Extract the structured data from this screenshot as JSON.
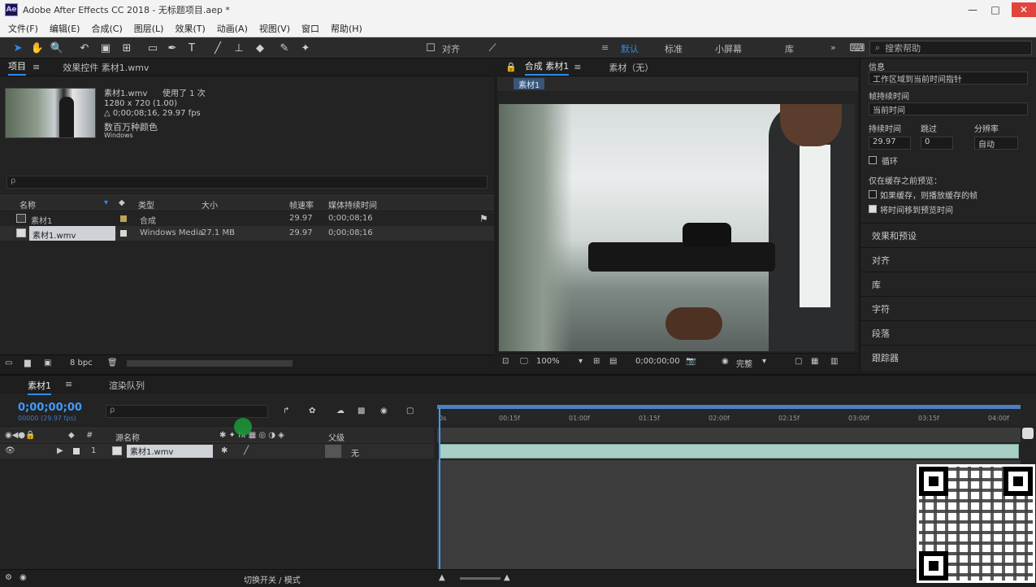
{
  "window": {
    "title": "Adobe After Effects CC 2018 - 无标题项目.aep *",
    "logo": "Ae",
    "controls": {
      "minimize": "—",
      "maximize": "□",
      "close": "✕"
    }
  },
  "menu": [
    "文件(F)",
    "编辑(E)",
    "合成(C)",
    "图层(L)",
    "效果(T)",
    "动画(A)",
    "视图(V)",
    "窗口",
    "帮助(H)"
  ],
  "toolbar": {
    "snap_label": "对齐",
    "workspaces": [
      "默认",
      "标准",
      "小屏幕",
      "库"
    ],
    "search_placeholder": "搜索帮助"
  },
  "project": {
    "tabs": [
      "项目",
      "效果控件 素材1.wmv"
    ],
    "item_name": "素材1.wmv",
    "item_usage": "使用了 1 次",
    "info_lines": [
      "1280 x 720 (1.00)",
      "△ 0;00;08;16, 29.97 fps",
      "数百万种颜色",
      "Windows"
    ],
    "search_placeholder": "ρ",
    "columns": [
      "名称",
      "类型",
      "大小",
      "帧速率",
      "媒体持续时间"
    ],
    "rows": [
      {
        "name": "素材1",
        "type": "合成",
        "size": "",
        "fps": "29.97",
        "duration": "0;00;08;16"
      },
      {
        "name": "素材1.wmv",
        "type": "Windows Media",
        "size": "27.1 MB",
        "fps": "29.97",
        "duration": "0;00;08;16"
      }
    ],
    "bpc": "8 bpc"
  },
  "composition": {
    "tabs": [
      "合成 素材1",
      "素材（无）"
    ],
    "subtab": "素材1",
    "zoom": "100%",
    "timecode": "0;00;00;00",
    "resolution": "完整"
  },
  "right_panel": {
    "title": "信息",
    "workspace_dropdown": "工作区域到当前时间指针",
    "frame_label": "帧持续时间",
    "frame_value": "当前时间",
    "fields_label": "持续时间",
    "fps": "29.97",
    "skip_label": "跳过",
    "skip_value": "0",
    "resolution_label": "分辨率",
    "resolution_value": "自动",
    "loop_label": "循环",
    "cache_title": "仅在缓存之前预览：",
    "option1": "如果缓存，则播放缓存的帧",
    "option2": "将时间移到预览时间",
    "sections": [
      "效果和预设",
      "对齐",
      "库",
      "字符",
      "段落",
      "跟踪器"
    ]
  },
  "timeline": {
    "tabs": [
      "素材1",
      "渲染队列"
    ],
    "timecode": "0;00;00;00",
    "timecode_sub": "00000 (29.97 fps)",
    "search_placeholder": "ρ",
    "columns": [
      "源名称",
      "父级"
    ],
    "layer_number": "1",
    "layer_name": "素材1.wmv",
    "parent_value": "无",
    "ruler_ticks": [
      "0s",
      "00:15f",
      "01:00f",
      "01:15f",
      "02:00f",
      "02:15f",
      "03:00f",
      "03:15f",
      "04:00f"
    ],
    "footer_label": "切换开关 / 模式"
  }
}
